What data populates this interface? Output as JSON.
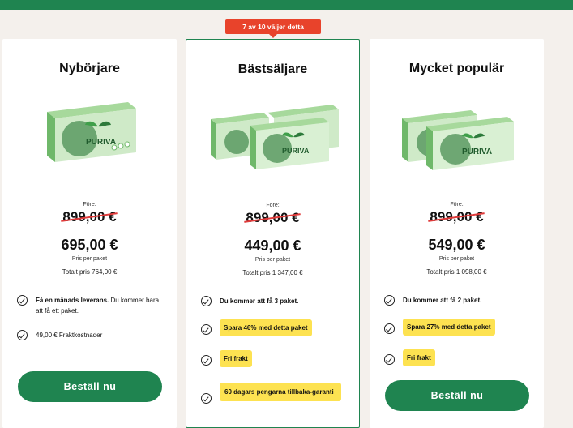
{
  "badge": "7 av 10 väljer detta",
  "cards": [
    {
      "title": "Nybörjare",
      "before_label": "Före:",
      "old_price": "899,00 €",
      "price": "695,00 €",
      "per_pkg": "Pris per paket",
      "total": "Totalt pris 764,00 €",
      "features": [
        {
          "bold": "Få en månads leverans.",
          "text": " Du kommer bara att få ett paket."
        },
        {
          "text": "49,00 € Fraktkostnader"
        }
      ],
      "button": "Beställ nu"
    },
    {
      "title": "Bästsäljare",
      "before_label": "Före:",
      "old_price": "899,00 €",
      "price": "449,00 €",
      "per_pkg": "Pris per paket",
      "total": "Totalt pris 1 347,00 €",
      "features": [
        {
          "text": "Du kommer att få 3 paket."
        },
        {
          "highlight": "Spara 46% med detta paket"
        },
        {
          "highlight": "Fri frakt"
        },
        {
          "highlight": "60 dagars pengarna tillbaka-garanti"
        }
      ]
    },
    {
      "title": "Mycket populär",
      "before_label": "Före:",
      "old_price": "899,00 €",
      "price": "549,00 €",
      "per_pkg": "Pris per paket",
      "total": "Totalt pris 1 098,00 €",
      "features": [
        {
          "text": "Du kommer att få 2 paket."
        },
        {
          "highlight": "Spara 27% med detta paket"
        },
        {
          "highlight": "Fri frakt"
        }
      ],
      "button": "Beställ nu"
    }
  ],
  "product_box_text": "PURIVA",
  "colors": {
    "brand": "#1f8450",
    "badge": "#e8432b",
    "highlight": "#fde251",
    "strike": "#e03b3b"
  }
}
